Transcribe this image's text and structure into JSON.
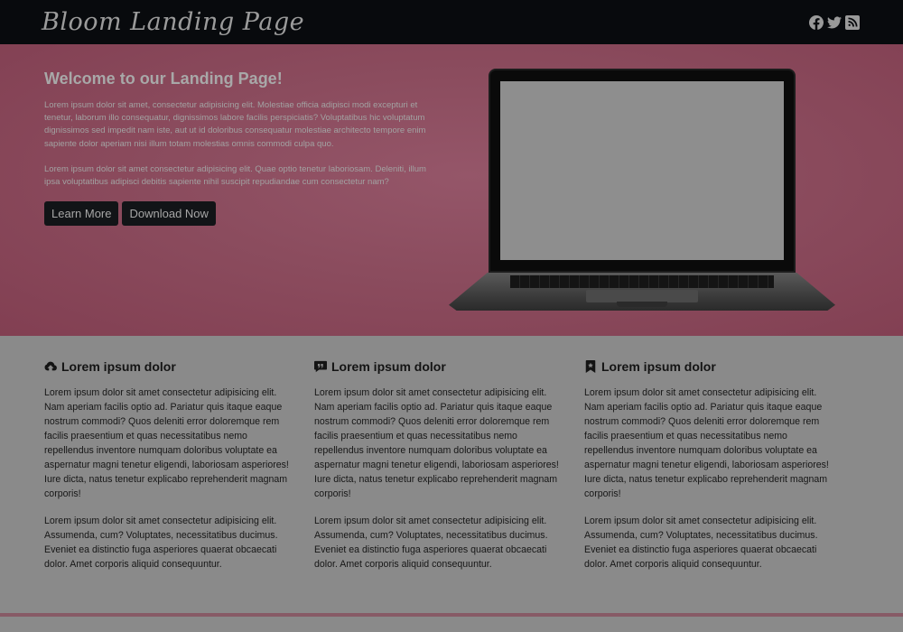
{
  "navbar": {
    "brand": "Bloom Landing Page",
    "social_icons": [
      "facebook-icon",
      "twitter-icon",
      "rss-icon"
    ]
  },
  "hero": {
    "title": "Welcome to our Landing Page!",
    "paragraph1": "Lorem ipsum dolor sit amet, consectetur adipisicing elit. Molestiae officia adipisci modi excepturi et tenetur, laborum illo consequatur, dignissimos labore facilis perspiciatis? Voluptatibus hic voluptatum dignissimos sed impedit nam iste, aut ut id doloribus consequatur molestiae architecto tempore enim sapiente dolor aperiam nisi illum totam molestias omnis commodi culpa quo.",
    "paragraph2": "Lorem ipsum dolor sit amet consectetur adipisicing elit. Quae optio tenetur laboriosam. Deleniti, illum ipsa voluptatibus adipisci debitis sapiente nihil suscipit repudiandae cum consectetur nam?",
    "learn_more_label": "Learn More",
    "download_label": "Download Now",
    "background_color": "#8b4c5e"
  },
  "features": [
    {
      "icon": "cloud-upload-icon",
      "title": "Lorem ipsum dolor",
      "paragraph1": "Lorem ipsum dolor sit amet consectetur adipisicing elit. Nam aperiam facilis optio ad. Pariatur quis itaque eaque nostrum commodi? Quos deleniti error doloremque rem facilis praesentium et quas necessitatibus nemo repellendus inventore numquam doloribus voluptate ea aspernatur magni tenetur eligendi, laboriosam asperiores! Iure dicta, natus tenetur explicabo reprehenderit magnam corporis!",
      "paragraph2": "Lorem ipsum dolor sit amet consectetur adipisicing elit. Assumenda, cum? Voluptates, necessitatibus ducimus. Eveniet ea distinctio fuga asperiores quaerat obcaecati dolor. Amet corporis aliquid consequuntur."
    },
    {
      "icon": "comment-quote-icon",
      "title": "Lorem ipsum dolor",
      "paragraph1": "Lorem ipsum dolor sit amet consectetur adipisicing elit. Nam aperiam facilis optio ad. Pariatur quis itaque eaque nostrum commodi? Quos deleniti error doloremque rem facilis praesentium et quas necessitatibus nemo repellendus inventore numquam doloribus voluptate ea aspernatur magni tenetur eligendi, laboriosam asperiores! Iure dicta, natus tenetur explicabo reprehenderit magnam corporis!",
      "paragraph2": "Lorem ipsum dolor sit amet consectetur adipisicing elit. Assumenda, cum? Voluptates, necessitatibus ducimus. Eveniet ea distinctio fuga asperiores quaerat obcaecati dolor. Amet corporis aliquid consequuntur."
    },
    {
      "icon": "bookmark-icon",
      "title": "Lorem ipsum dolor",
      "paragraph1": "Lorem ipsum dolor sit amet consectetur adipisicing elit. Nam aperiam facilis optio ad. Pariatur quis itaque eaque nostrum commodi? Quos deleniti error doloremque rem facilis praesentium et quas necessitatibus nemo repellendus inventore numquam doloribus voluptate ea aspernatur magni tenetur eligendi, laboriosam asperiores! Iure dicta, natus tenetur explicabo reprehenderit magnam corporis!",
      "paragraph2": "Lorem ipsum dolor sit amet consectetur adipisicing elit. Assumenda, cum? Voluptates, necessitatibus ducimus. Eveniet ea distinctio fuga asperiores quaerat obcaecati dolor. Amet corporis aliquid consequuntur."
    }
  ]
}
